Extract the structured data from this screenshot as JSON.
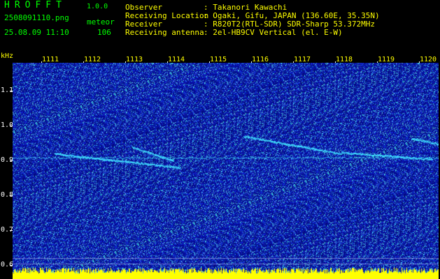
{
  "colors": {
    "header_green": "#00ff00",
    "info_yellow": "#ffff00",
    "axis_yellow": "#ffff00",
    "freq_label": "#ffffff",
    "tick_mark": "#ffffff",
    "bg_blue": "#0a14a0",
    "signal_cyan": "#40e0ff",
    "noise_yellow": "#ffff00"
  },
  "header": {
    "app_title": "HROFFT",
    "app_version": "1.0.0",
    "file_name": "2508091110.png",
    "detect_type": "meteor",
    "date_time": "25.08.09 11:10",
    "count": "106"
  },
  "info": [
    {
      "label": "Observer",
      "value": ": Takanori Kawachi"
    },
    {
      "label": "Receiving Location",
      "value": ": Ogaki, Gifu, JAPAN (136.60E, 35.35N)"
    },
    {
      "label": "Receiver",
      "value": ": R820T2(RTL-SDR) SDR-Sharp 53.372MHz"
    },
    {
      "label": "Receiving antenna",
      "value": ": 2el-HB9CV Vertical (el. E-W)"
    }
  ],
  "axis": {
    "y_unit": "kHz",
    "minute_labels": [
      "1111",
      "1112",
      "1113",
      "1114",
      "1115",
      "1116",
      "1117",
      "1118",
      "1119",
      "1120"
    ],
    "freq_labels": [
      "1.1",
      "1.0",
      "0.9",
      "0.8",
      "0.7",
      "0.6"
    ]
  }
}
